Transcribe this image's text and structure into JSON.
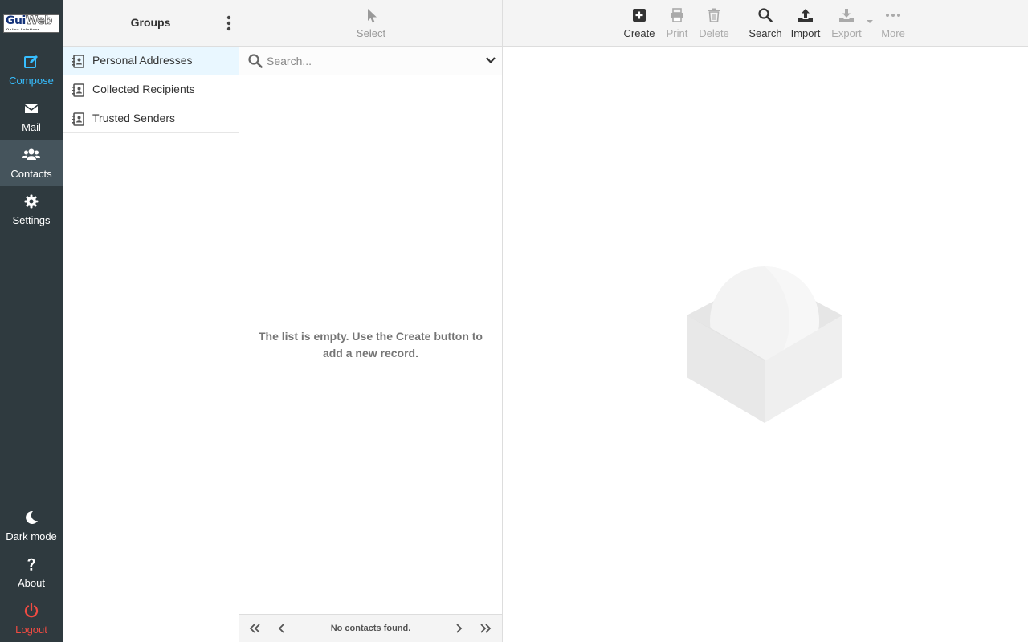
{
  "nav": {
    "logo_main_a": "Gui",
    "logo_main_b": "Web",
    "logo_sub": "Online Solutions",
    "compose": "Compose",
    "mail": "Mail",
    "contacts": "Contacts",
    "settings": "Settings",
    "dark_mode": "Dark mode",
    "about": "About",
    "logout": "Logout"
  },
  "groups": {
    "title": "Groups",
    "items": [
      {
        "label": "Personal Addresses",
        "icon": "address-book-icon",
        "selected": true
      },
      {
        "label": "Collected Recipients",
        "icon": "address-book-icon",
        "selected": false
      },
      {
        "label": "Trusted Senders",
        "icon": "address-book-icon",
        "selected": false
      }
    ]
  },
  "list": {
    "select_label": "Select",
    "search_placeholder": "Search...",
    "empty_message": "The list is empty. Use the Create button to add a new record.",
    "count_text": "No contacts found."
  },
  "toolbar": {
    "create": "Create",
    "print": "Print",
    "delete": "Delete",
    "search": "Search",
    "import": "Import",
    "export": "Export",
    "more": "More"
  },
  "colors": {
    "sidebar_bg": "#2f3a3f",
    "accent": "#37beff",
    "logout": "#f14b42",
    "selected_row": "#e9f7ff"
  }
}
